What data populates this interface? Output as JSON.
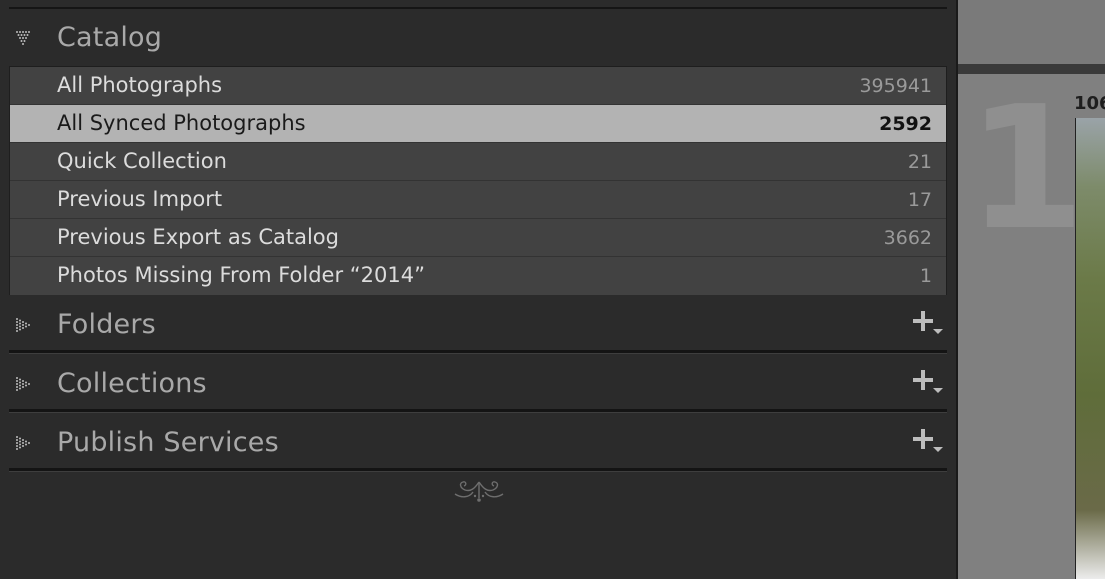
{
  "sections": {
    "catalog": {
      "title": "Catalog",
      "items": [
        {
          "label": "All Photographs",
          "count": "395941"
        },
        {
          "label": "All Synced Photographs",
          "count": "2592"
        },
        {
          "label": "Quick Collection",
          "count": "21"
        },
        {
          "label": "Previous Import",
          "count": "17"
        },
        {
          "label": "Previous Export as Catalog",
          "count": "3662"
        },
        {
          "label": "Photos Missing From Folder “2014”",
          "count": "1"
        }
      ],
      "selected_index": 1
    },
    "folders": {
      "title": "Folders"
    },
    "collections": {
      "title": "Collections"
    },
    "publish_services": {
      "title": "Publish Services"
    }
  },
  "preview": {
    "label": "106",
    "grid_index": "1"
  },
  "colors": {
    "panel_bg": "#2b2b2b",
    "row_bg": "#424242",
    "row_selected_bg": "#b3b3b3",
    "header_text": "#a9a9a9"
  },
  "icons": {
    "expanded": "triangle-down-icon",
    "collapsed": "triangle-right-icon",
    "add": "plus-dropdown-icon",
    "ornament": "flourish-ornament-icon"
  }
}
